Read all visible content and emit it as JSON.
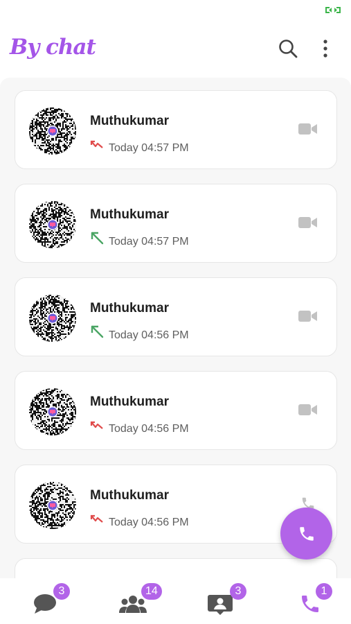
{
  "app": {
    "title": "By chat"
  },
  "colors": {
    "accent": "#b264e8",
    "missed": "#e04c4c",
    "outgoing": "#4aa564",
    "icon_gray": "#c2c2c2"
  },
  "header": {
    "search_icon": "search-icon",
    "menu_icon": "more-vert-icon"
  },
  "calls": [
    {
      "name": "Muthukumar",
      "time": "Today 04:57 PM",
      "direction": "missed",
      "type": "video"
    },
    {
      "name": "Muthukumar",
      "time": "Today 04:57 PM",
      "direction": "outgoing",
      "type": "video"
    },
    {
      "name": "Muthukumar",
      "time": "Today 04:56 PM",
      "direction": "outgoing",
      "type": "video"
    },
    {
      "name": "Muthukumar",
      "time": "Today 04:56 PM",
      "direction": "missed",
      "type": "video"
    },
    {
      "name": "Muthukumar",
      "time": "Today 04:56 PM",
      "direction": "missed",
      "type": "voice"
    }
  ],
  "fab": {
    "icon": "phone-icon"
  },
  "bottom_nav": [
    {
      "icon": "chat-icon",
      "badge": "3",
      "active": false
    },
    {
      "icon": "groups-icon",
      "badge": "14",
      "active": false
    },
    {
      "icon": "status-icon",
      "badge": "3",
      "active": false
    },
    {
      "icon": "calls-icon",
      "badge": "1",
      "active": true
    }
  ]
}
